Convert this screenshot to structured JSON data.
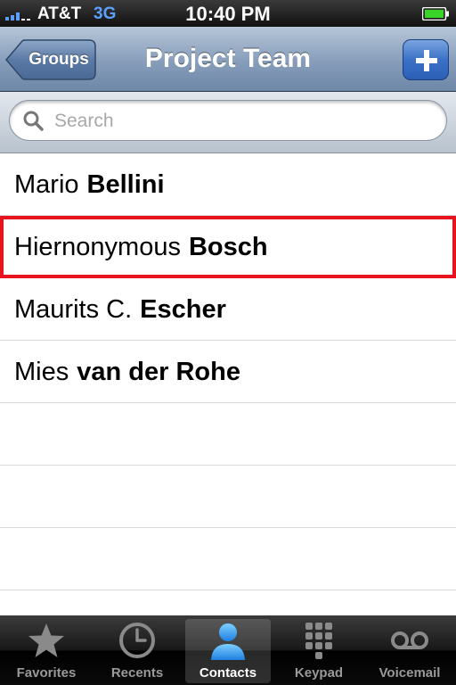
{
  "status_bar": {
    "carrier": "AT&T",
    "network": "3G",
    "time": "10:40 PM"
  },
  "nav": {
    "back_label": "Groups",
    "title": "Project Team",
    "add_icon": "plus-icon"
  },
  "search": {
    "placeholder": "Search",
    "value": ""
  },
  "contacts": [
    {
      "first": "Mario",
      "last": "Bellini"
    },
    {
      "first": "Hiernonymous",
      "last": "Bosch"
    },
    {
      "first": "Maurits C.",
      "last": "Escher"
    },
    {
      "first": "Mies",
      "last": "van der Rohe"
    }
  ],
  "tabs": [
    {
      "label": "Favorites",
      "icon": "star-icon"
    },
    {
      "label": "Recents",
      "icon": "clock-icon"
    },
    {
      "label": "Contacts",
      "icon": "person-icon",
      "selected": true
    },
    {
      "label": "Keypad",
      "icon": "keypad-icon"
    },
    {
      "label": "Voicemail",
      "icon": "voicemail-icon"
    }
  ],
  "colors": {
    "highlight": "#e8141d",
    "nav_bar": "#8aa0bc",
    "accent_blue": "#3b71c6",
    "battery": "#38d428"
  }
}
